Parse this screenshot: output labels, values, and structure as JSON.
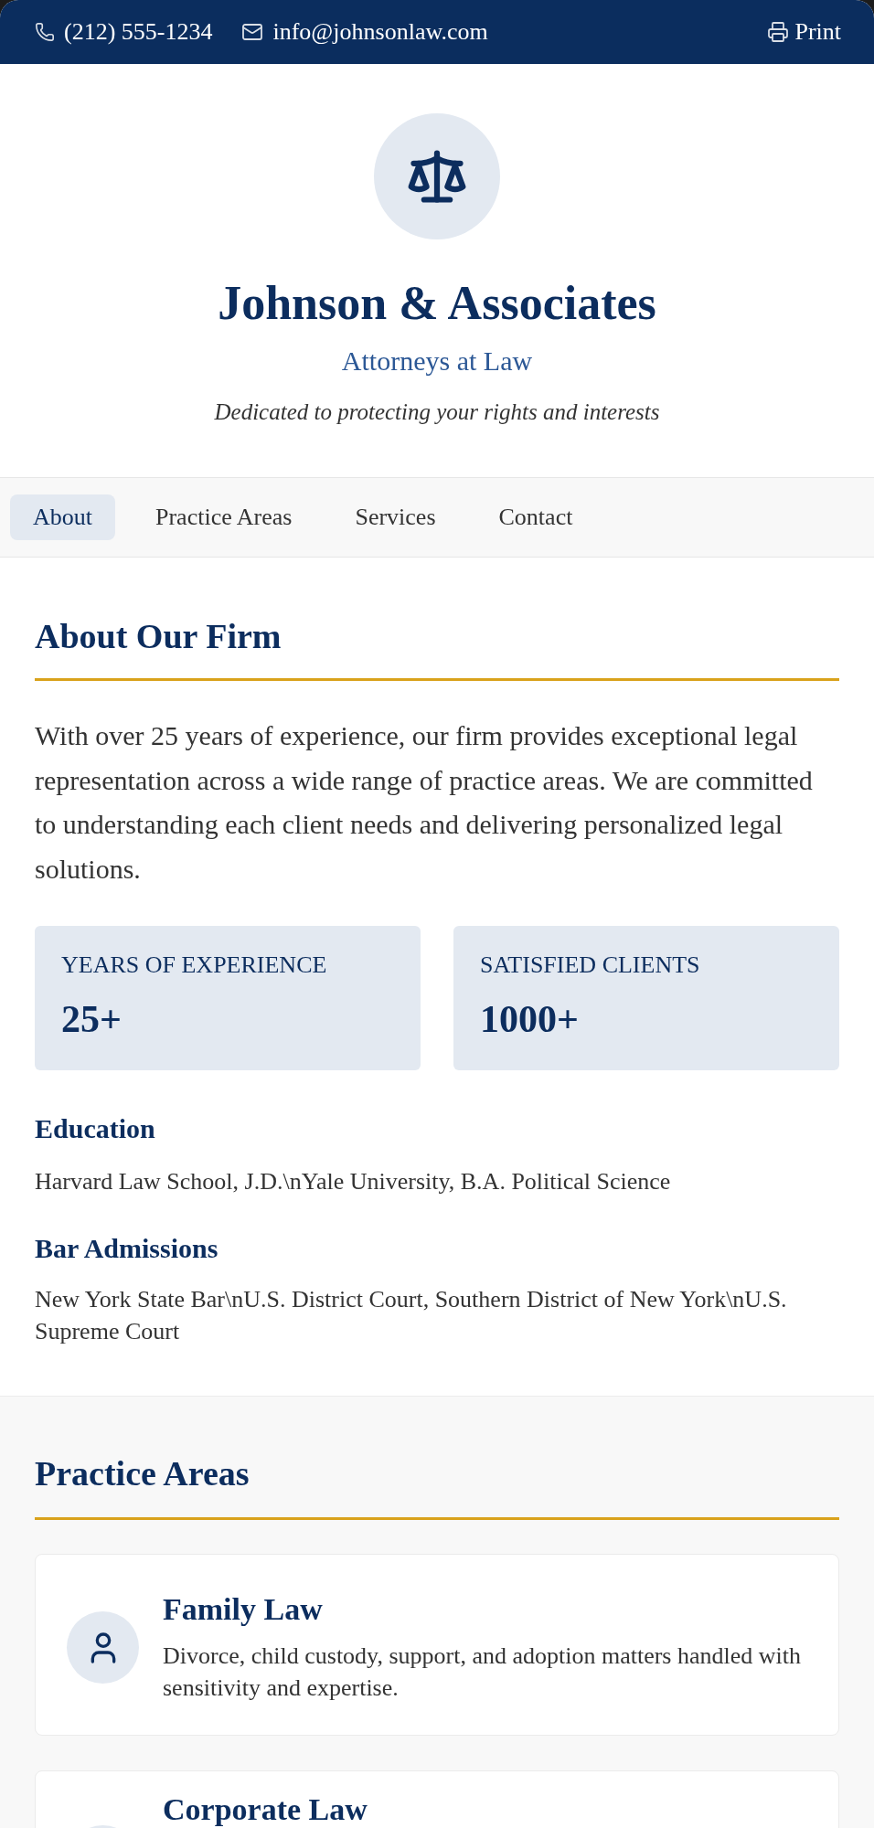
{
  "top_bar": {
    "phone": "(212) 555-1234",
    "email": "info@johnsonlaw.com",
    "print_label": "Print"
  },
  "header": {
    "title": "Johnson & Associates",
    "subtitle": "Attorneys at Law",
    "tagline": "Dedicated to protecting your rights and interests"
  },
  "tabs": [
    {
      "label": "About",
      "selected": true
    },
    {
      "label": "Practice Areas",
      "selected": false
    },
    {
      "label": "Services",
      "selected": false
    },
    {
      "label": "Contact",
      "selected": false
    }
  ],
  "about": {
    "heading": "About Our Firm",
    "paragraph": "With over 25 years of experience, our firm provides exceptional legal representation across a wide range of practice areas. We are committed to understanding each client needs and delivering personalized legal solutions.",
    "stats": [
      {
        "label": "YEARS OF EXPERIENCE",
        "value": "25+"
      },
      {
        "label": "SATISFIED CLIENTS",
        "value": "1000+"
      }
    ],
    "details": [
      {
        "heading": "Education",
        "text": "Harvard Law School, J.D.\\nYale University, B.A. Political Science"
      },
      {
        "heading": "Bar Admissions",
        "text": "New York State Bar\\nU.S. District Court, Southern District of New York\\nU.S. Supreme Court"
      }
    ]
  },
  "practice_areas": {
    "heading": "Practice Areas",
    "items": [
      {
        "title": "Family Law",
        "description": "Divorce, child custody, support, and adoption matters handled with sensitivity and expertise."
      },
      {
        "title": "Corporate Law"
      }
    ]
  }
}
